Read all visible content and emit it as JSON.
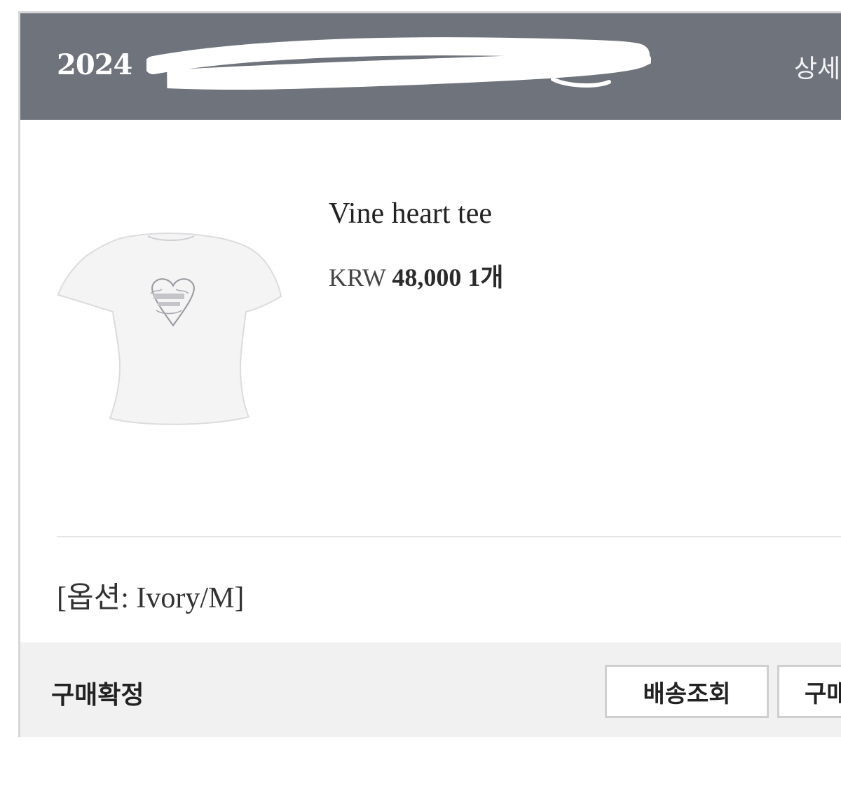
{
  "order": {
    "date_visible": "2024",
    "detail_link": "상세"
  },
  "product": {
    "name": "Vine heart tee",
    "currency": "KRW",
    "price": "48,000",
    "quantity": "1개",
    "image_icon": "white-tshirt-heart-print"
  },
  "option": {
    "text": "[옵션: Ivory/M]"
  },
  "footer": {
    "status": "구매확정",
    "track_button": "배송조회",
    "second_button": "구매"
  },
  "colors": {
    "header_bg": "#6f737b",
    "footer_bg": "#f1f1f2",
    "border": "#d6d6d8"
  }
}
